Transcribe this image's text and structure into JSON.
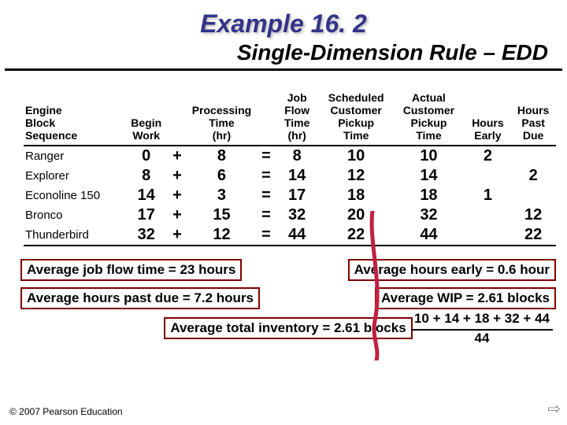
{
  "title": "Example 16. 2",
  "subtitle": "Single-Dimension Rule – EDD",
  "headers": {
    "engine": "Engine\nBlock\nSequence",
    "begin": "Begin\nWork",
    "plus": "",
    "proc": "Processing\nTime\n(hr)",
    "eq": "",
    "flow": "Job\nFlow\nTime\n(hr)",
    "sched": "Scheduled\nCustomer\nPickup\nTime",
    "actual": "Actual\nCustomer\nPickup\nTime",
    "early": "Hours\nEarly",
    "past": "Hours\nPast\nDue"
  },
  "rows": [
    {
      "engine": "Ranger",
      "begin": "0",
      "plus": "+",
      "proc": "8",
      "eq": "=",
      "flow": "8",
      "sched": "10",
      "actual": "10",
      "early": "2",
      "past": ""
    },
    {
      "engine": "Explorer",
      "begin": "8",
      "plus": "+",
      "proc": "6",
      "eq": "=",
      "flow": "14",
      "sched": "12",
      "actual": "14",
      "early": "",
      "past": "2"
    },
    {
      "engine": "Econoline 150",
      "begin": "14",
      "plus": "+",
      "proc": "3",
      "eq": "=",
      "flow": "17",
      "sched": "18",
      "actual": "18",
      "early": "1",
      "past": ""
    },
    {
      "engine": "Bronco",
      "begin": "17",
      "plus": "+",
      "proc": "15",
      "eq": "=",
      "flow": "32",
      "sched": "20",
      "actual": "32",
      "early": "",
      "past": "12"
    },
    {
      "engine": "Thunderbird",
      "begin": "32",
      "plus": "+",
      "proc": "12",
      "eq": "=",
      "flow": "44",
      "sched": "22",
      "actual": "44",
      "early": "",
      "past": "22"
    }
  ],
  "summary": {
    "avg_flow": "Average job flow time = 23 hours",
    "avg_early": "Average hours early = 0.6 hour",
    "avg_past": "Average hours past due = 7.2 hours",
    "avg_wip": "Average WIP = 2.61 blocks",
    "avg_total": "Average total inventory = 2.61 blocks"
  },
  "calc": {
    "numerator": "10 + 14 + 18 + 32 + 44",
    "denominator": "44",
    "side_top": "+ 44",
    "side_bot": ""
  },
  "copyright": "© 2007 Pearson Education",
  "chart_data": {
    "type": "table",
    "title": "Example 16.2 Single-Dimension Rule – EDD",
    "columns": [
      "Engine Block Sequence",
      "Begin Work",
      "Processing Time (hr)",
      "Job Flow Time (hr)",
      "Scheduled Customer Pickup Time",
      "Actual Customer Pickup Time",
      "Hours Early",
      "Hours Past Due"
    ],
    "rows": [
      [
        "Ranger",
        0,
        8,
        8,
        10,
        10,
        2,
        null
      ],
      [
        "Explorer",
        8,
        6,
        14,
        12,
        14,
        null,
        2
      ],
      [
        "Econoline 150",
        14,
        3,
        17,
        18,
        18,
        1,
        null
      ],
      [
        "Bronco",
        17,
        15,
        32,
        20,
        32,
        null,
        12
      ],
      [
        "Thunderbird",
        32,
        12,
        44,
        22,
        44,
        null,
        22
      ]
    ],
    "aggregates": {
      "average_job_flow_time_hours": 23,
      "average_hours_early": 0.6,
      "average_hours_past_due": 7.2,
      "average_wip_blocks": 2.61,
      "average_total_inventory_blocks": 2.61
    }
  }
}
